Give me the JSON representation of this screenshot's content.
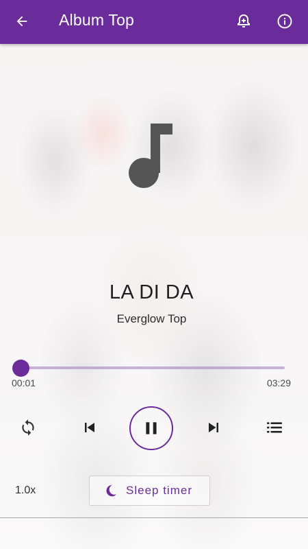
{
  "appbar": {
    "title": "Album Top",
    "back_icon": "arrow-left-icon",
    "alarm_icon": "alarm-add-icon",
    "info_icon": "info-icon"
  },
  "artwork": {
    "icon": "music-note-icon"
  },
  "song": {
    "title": "LA DI DA",
    "artist": "Everglow Top"
  },
  "progress": {
    "current": "00:01",
    "duration": "03:29",
    "fraction": 0.005
  },
  "controls": {
    "repeat_icon": "repeat-icon",
    "prev_icon": "skip-previous-icon",
    "play_pause_icon": "pause-icon",
    "next_icon": "skip-next-icon",
    "queue_icon": "queue-list-icon"
  },
  "footer": {
    "speed": "1.0x",
    "sleep_timer_label": "Sleep timer",
    "sleep_icon": "moon-icon"
  },
  "colors": {
    "primary": "#6a2c9a",
    "text": "#1e1e1e"
  }
}
